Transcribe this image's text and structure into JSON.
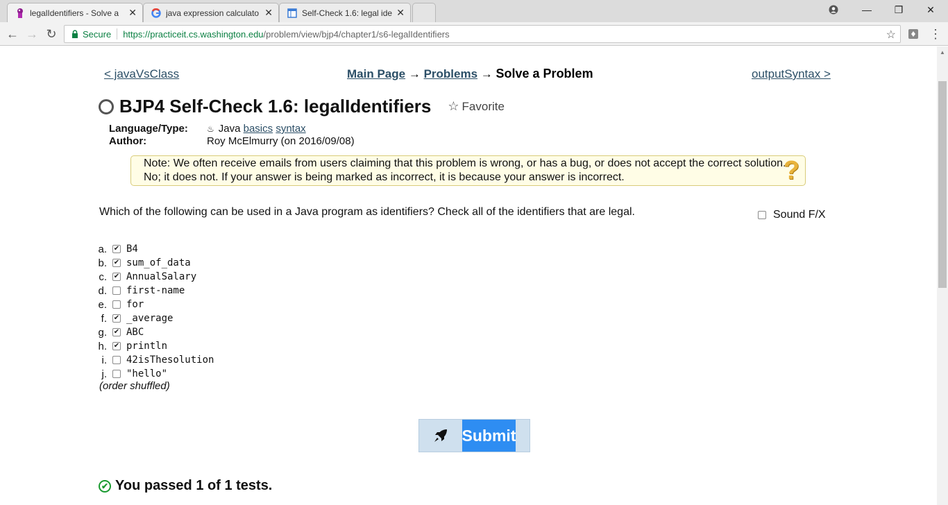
{
  "browser": {
    "tabs": [
      {
        "title": "legalIdentifiers - Solve a",
        "favicon": "practiceit-icon",
        "active": true
      },
      {
        "title": "java expression calculato",
        "favicon": "google-icon",
        "active": false
      },
      {
        "title": "Self-Check 1.6: legal iden",
        "favicon": "doc-icon",
        "active": false
      }
    ],
    "secure_label": "Secure",
    "url_host": "https://practiceit.cs.washington.edu",
    "url_path": "/problem/view/bjp4/chapter1/s6-legalIdentifiers"
  },
  "nav": {
    "prev": "< javaVsClass",
    "next": "outputSyntax >",
    "breadcrumb": {
      "main": "Main Page",
      "arrow1": "→",
      "problems": "Problems",
      "arrow2": "→",
      "current": "Solve a Problem"
    }
  },
  "problem": {
    "title": "BJP4 Self-Check 1.6: legalIdentifiers",
    "favorite": "Favorite",
    "lang_label": "Language/Type:",
    "lang": "Java",
    "tag1": "basics",
    "tag2": "syntax",
    "author_label": "Author:",
    "author": "Roy McElmurry (on 2016/09/08)",
    "note": "Note: We often receive emails from users claiming that this problem is wrong, or has a bug, or does not accept the correct solution. No; it does not. If your answer is being marked as incorrect, it is because your answer is incorrect.",
    "question": "Which of the following can be used in a Java program as identifiers? Check all of the identifiers that are legal.",
    "sound": "Sound F/X",
    "choices": [
      {
        "letter": "a.",
        "code": "B4",
        "checked": true
      },
      {
        "letter": "b.",
        "code": "sum_of_data",
        "checked": true
      },
      {
        "letter": "c.",
        "code": "AnnualSalary",
        "checked": true
      },
      {
        "letter": "d.",
        "code": "first-name",
        "checked": false
      },
      {
        "letter": "e.",
        "code": "for",
        "checked": false
      },
      {
        "letter": "f.",
        "code": "_average",
        "checked": true
      },
      {
        "letter": "g.",
        "code": "ABC",
        "checked": true
      },
      {
        "letter": "h.",
        "code": "println",
        "checked": true
      },
      {
        "letter": "i.",
        "code": "42isThesolution",
        "checked": false
      },
      {
        "letter": "j.",
        "code": "\"hello\"",
        "checked": false
      }
    ],
    "shuffled": "(order shuffled)",
    "submit": "Submit",
    "result": "You passed 1 of 1 tests."
  }
}
